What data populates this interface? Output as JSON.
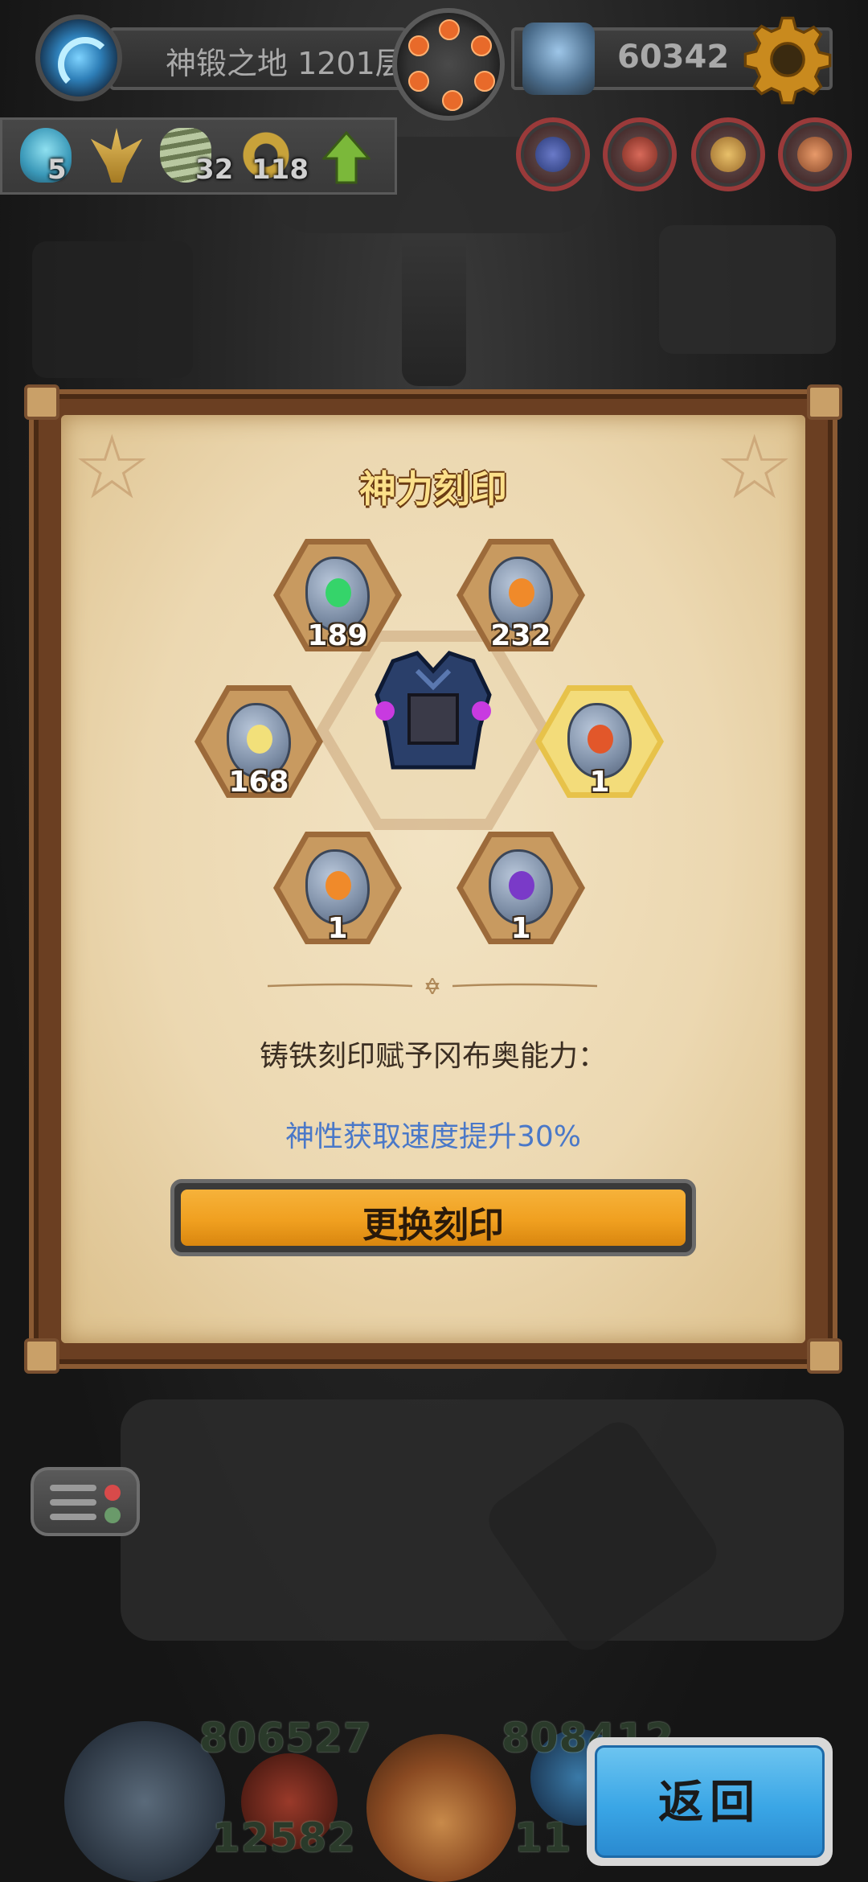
{
  "top_bar": {
    "floor_label": "神锻之地 1201层",
    "gold_amount": "60342"
  },
  "resources": [
    {
      "icon": "blue-spirit-icon",
      "value": "5"
    },
    {
      "icon": "golden-candelabra-icon",
      "value": ""
    },
    {
      "icon": "whirlwind-icon",
      "value": "32"
    },
    {
      "icon": "laurel-wreath-icon",
      "value": "118"
    }
  ],
  "dialog": {
    "title": "神力刻印",
    "slots": [
      {
        "count": "189",
        "rune_color": "#35d46a",
        "selected": false
      },
      {
        "count": "232",
        "rune_color": "#f08a2a",
        "selected": false
      },
      {
        "count": "168",
        "rune_color": "#f2e07a",
        "selected": false
      },
      {
        "count": "1",
        "rune_color": "#e2572a",
        "selected": true
      },
      {
        "count": "1",
        "rune_color": "#f08a2a",
        "selected": false
      },
      {
        "count": "1",
        "rune_color": "#7a3ac8",
        "selected": false
      }
    ],
    "description": "铸铁刻印赋予冈布奥能力：",
    "effect": "神性获取速度提升30%",
    "swap_button": "更换刻印"
  },
  "bottom": {
    "stat_left": "806527",
    "stat_right": "808412",
    "stat_left_2": "12582",
    "stat_right_2": "11",
    "back_button": "返回"
  },
  "colors": {
    "accent_orange": "#f0a020",
    "effect_blue": "#4a78c8",
    "back_blue": "#3aa6e6"
  }
}
